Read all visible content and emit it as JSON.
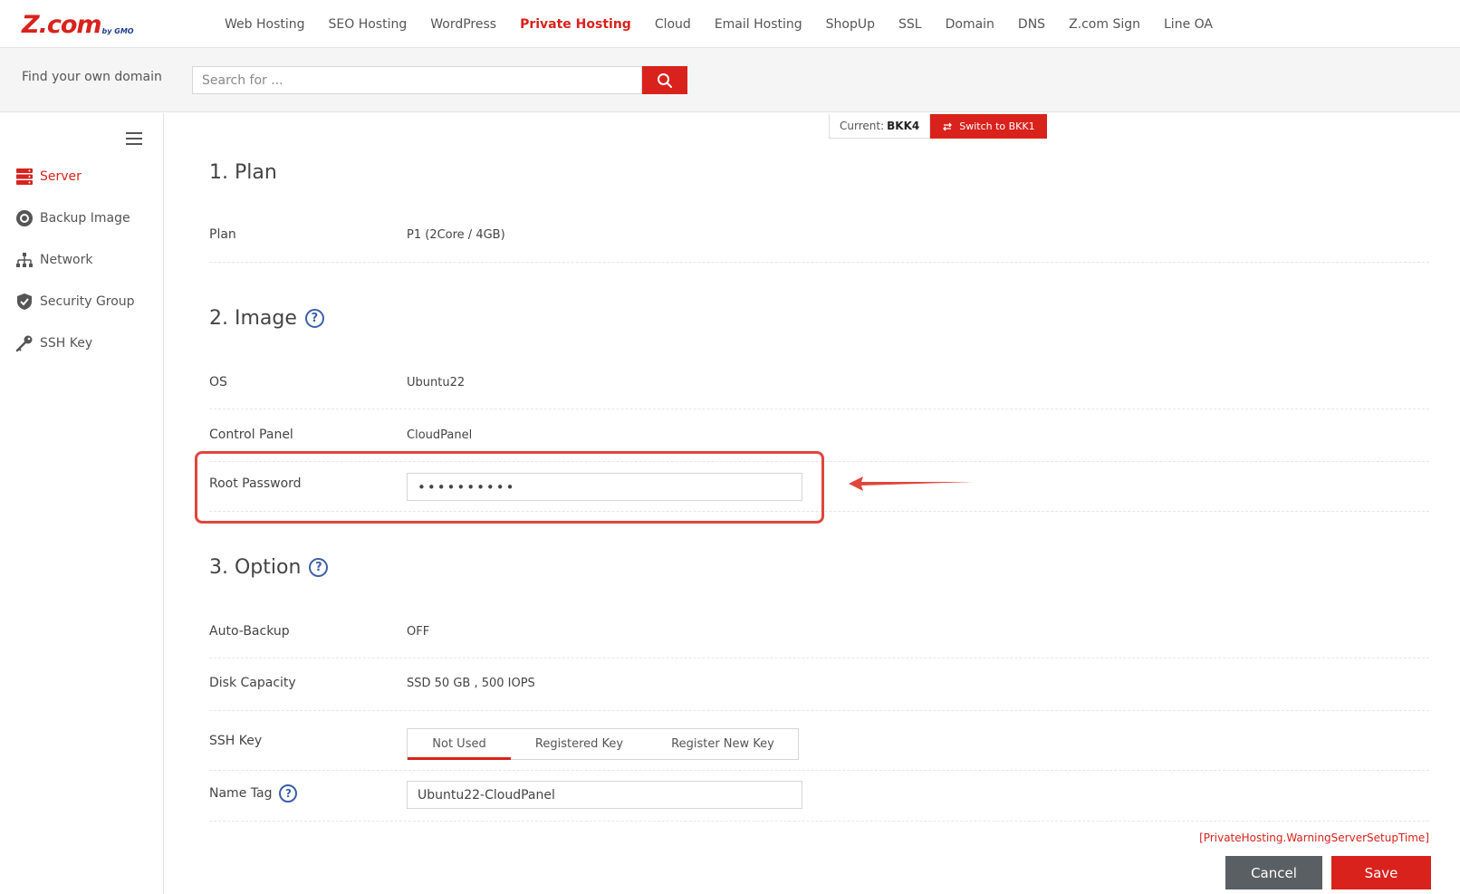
{
  "brand": {
    "logo": "Z.com",
    "logo_sub": "by GMO"
  },
  "nav": {
    "items": [
      {
        "label": "Web Hosting"
      },
      {
        "label": "SEO Hosting"
      },
      {
        "label": "WordPress"
      },
      {
        "label": "Private Hosting",
        "active": true
      },
      {
        "label": "Cloud"
      },
      {
        "label": "Email Hosting"
      },
      {
        "label": "ShopUp"
      },
      {
        "label": "SSL"
      },
      {
        "label": "Domain"
      },
      {
        "label": "DNS"
      },
      {
        "label": "Z.com Sign"
      },
      {
        "label": "Line OA"
      }
    ]
  },
  "search": {
    "label": "Find your own domain",
    "placeholder": "Search for ..."
  },
  "sidebar": {
    "items": [
      {
        "label": "Server",
        "icon": "server-icon",
        "active": true
      },
      {
        "label": "Backup Image",
        "icon": "disc-icon"
      },
      {
        "label": "Network",
        "icon": "network-icon"
      },
      {
        "label": "Security Group",
        "icon": "shield-icon"
      },
      {
        "label": "SSH Key",
        "icon": "key-icon"
      }
    ]
  },
  "region": {
    "current_label": "Current:",
    "current_value": "BKK4",
    "switch_label": "Switch to BKK1"
  },
  "sections": {
    "plan": {
      "title": "1. Plan",
      "plan_label": "Plan",
      "plan_value": "P1 (2Core / 4GB)"
    },
    "image": {
      "title": "2. Image",
      "os_label": "OS",
      "os_value": "Ubuntu22",
      "panel_label": "Control Panel",
      "panel_value": "CloudPanel",
      "password_label": "Root Password",
      "password_value": "••••••••••"
    },
    "option": {
      "title": "3. Option",
      "backup_label": "Auto-Backup",
      "backup_value": "OFF",
      "disk_label": "Disk Capacity",
      "disk_value": "SSD 50 GB , 500 IOPS",
      "ssh_label": "SSH Key",
      "ssh_options": [
        "Not Used",
        "Registered Key",
        "Register New Key"
      ],
      "ssh_selected": "Not Used",
      "nametag_label": "Name Tag",
      "nametag_value": "Ubuntu22-CloudPanel"
    }
  },
  "footer": {
    "warning": "[PrivateHosting.WarningServerSetupTime]",
    "cancel_label": "Cancel",
    "save_label": "Save"
  },
  "colors": {
    "accent": "#d9221c",
    "help": "#3b5fa8",
    "highlight": "#e0463c"
  }
}
